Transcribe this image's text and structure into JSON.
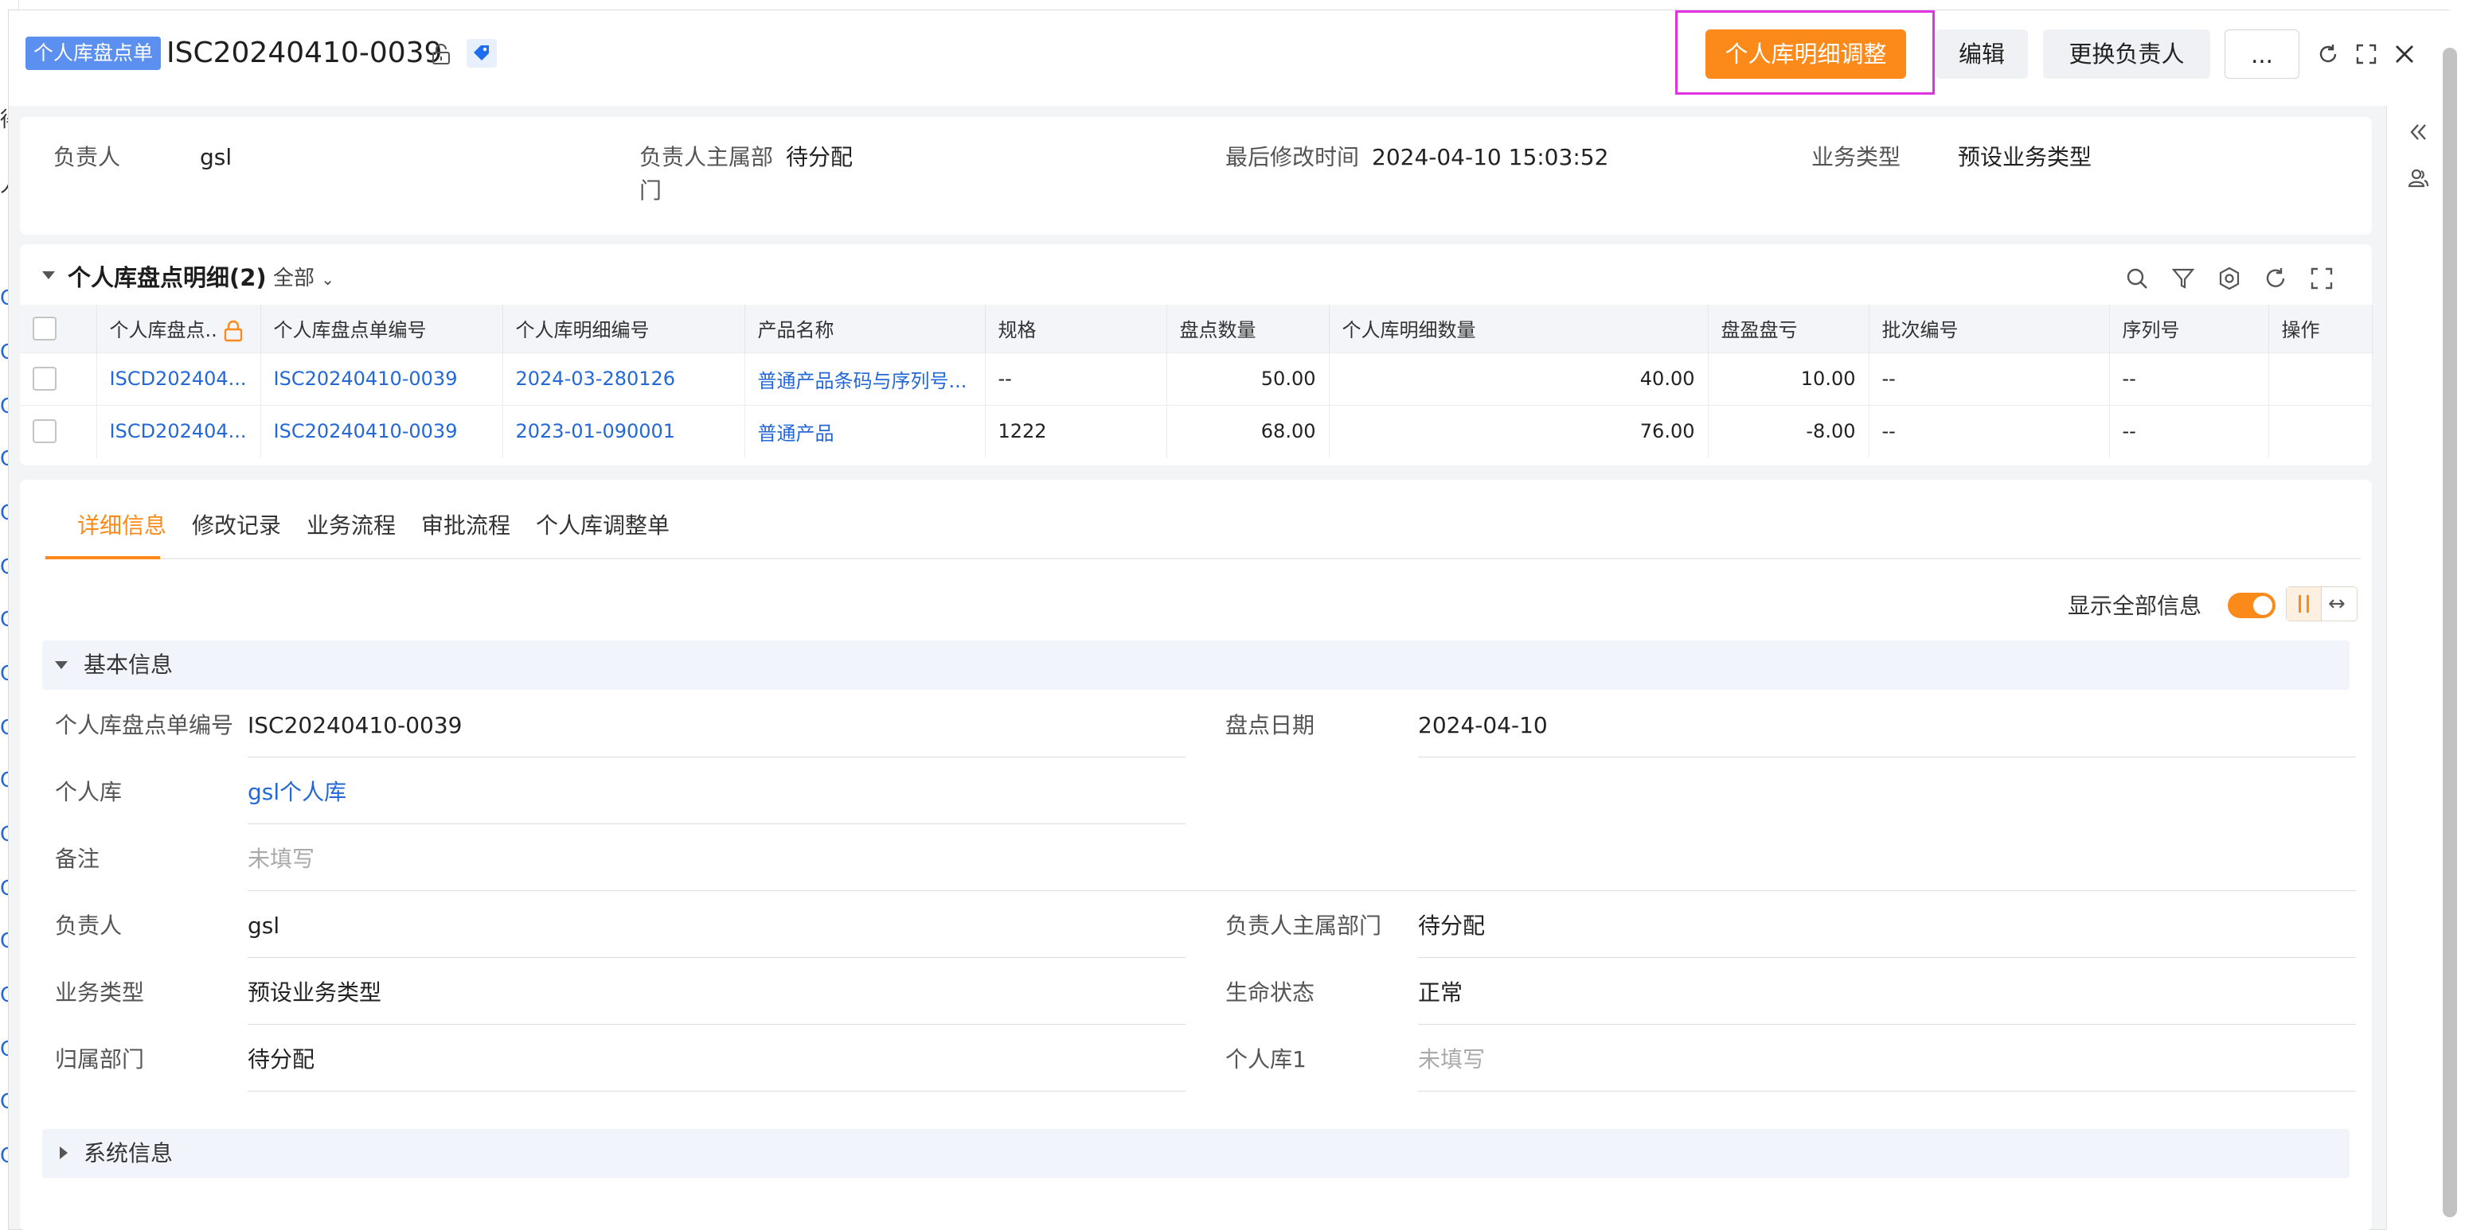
{
  "header": {
    "object_tag": "个人库盘点单",
    "record_title": "ISC20240410-0039",
    "buttons": {
      "adjust": "个人库明细调整",
      "edit": "编辑",
      "change_owner": "更换负责人",
      "more": "..."
    }
  },
  "background_left": [
    "人",
    "得",
    "C",
    "C",
    "C",
    "C",
    "C",
    "C",
    "C",
    "C",
    "C",
    "C",
    "C",
    "C",
    "C",
    "C",
    "C",
    "C",
    "C"
  ],
  "summary": [
    {
      "label": "负责人",
      "value": "gsl"
    },
    {
      "label": "负责人主属部",
      "label2": "门",
      "value": "待分配"
    },
    {
      "label": "最后修改时间",
      "value": "2024-04-10 15:03:52"
    },
    {
      "label": "业务类型",
      "value": "预设业务类型"
    }
  ],
  "detail": {
    "title": "个人库盘点明细(2)",
    "filter": "全部",
    "columns": [
      "个人库盘点..",
      "个人库盘点单编号",
      "个人库明细编号",
      "产品名称",
      "规格",
      "盘点数量",
      "个人库明细数量",
      "盘盈盘亏",
      "批次编号",
      "序列号",
      "操作"
    ],
    "rows": [
      [
        "ISCD202404...",
        "ISC20240410-0039",
        "2024-03-280126",
        "普通产品条码与序列号...",
        "--",
        "50.00",
        "40.00",
        "10.00",
        "--",
        "--",
        ""
      ],
      [
        "ISCD202404...",
        "ISC20240410-0039",
        "2023-01-090001",
        "普通产品",
        "1222",
        "68.00",
        "76.00",
        "-8.00",
        "--",
        "--",
        ""
      ]
    ]
  },
  "tabs": [
    {
      "label": "详细信息",
      "active": true
    },
    {
      "label": "修改记录"
    },
    {
      "label": "业务流程"
    },
    {
      "label": "审批流程"
    },
    {
      "label": "个人库调整单"
    }
  ],
  "show_all": {
    "label": "显示全部信息",
    "on": true,
    "switch_alt": "↔"
  },
  "sections": {
    "basic": "基本信息",
    "system": "系统信息"
  },
  "fields": {
    "code": {
      "label": "个人库盘点单编号",
      "value": "ISC20240410-0039"
    },
    "date": {
      "label": "盘点日期",
      "value": "2024-04-10"
    },
    "warehouse": {
      "label": "个人库",
      "value": "gsl个人库"
    },
    "remark": {
      "label": "备注",
      "value": "未填写"
    },
    "owner": {
      "label": "负责人",
      "value": "gsl"
    },
    "owner_dept": {
      "label": "负责人主属部门",
      "value": "待分配"
    },
    "biz_type": {
      "label": "业务类型",
      "value": "预设业务类型"
    },
    "life_status": {
      "label": "生命状态",
      "value": "正常"
    },
    "dept": {
      "label": "归属部门",
      "value": "待分配"
    },
    "warehouse1": {
      "label": "个人库1",
      "value": "未填写"
    }
  },
  "colors": {
    "accent": "#fb8a1b",
    "link": "#2468d8",
    "tag": "#5b8ff0",
    "highlight": "#e233e2"
  }
}
